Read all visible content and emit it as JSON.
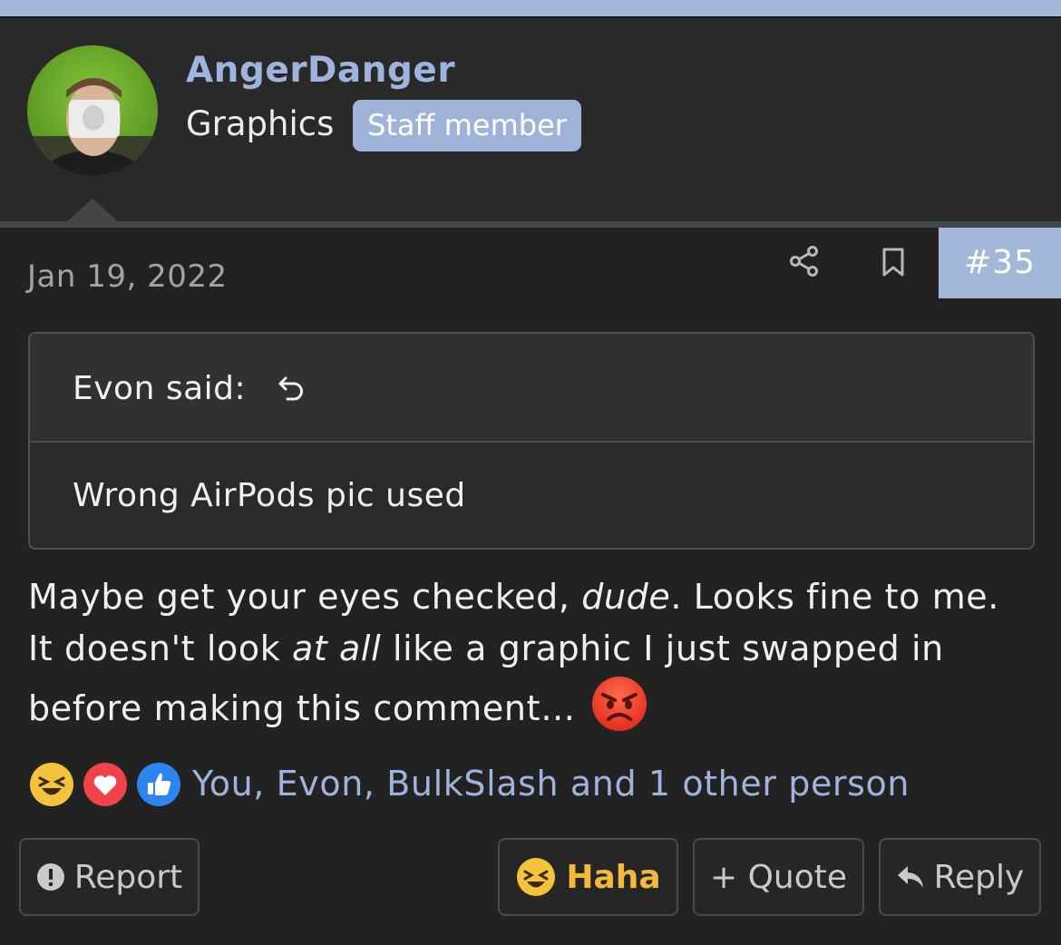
{
  "colors": {
    "accent": "#9fb4dc",
    "badge": "#9fb3d8",
    "post_number_bg": "#a3b7d9",
    "background": "#222223",
    "haha_text": "#f2b93c"
  },
  "header": {
    "username": "AngerDanger",
    "user_title": "Graphics",
    "badge": "Staff member",
    "avatar_icon": "user-avatar-photo"
  },
  "post": {
    "date": "Jan 19, 2022",
    "number": "#35",
    "share_icon": "share-icon",
    "bookmark_icon": "bookmark-icon"
  },
  "quote": {
    "author": "Evon said:",
    "jump_icon": "undo-arrow-icon",
    "text": "Wrong AirPods pic used"
  },
  "body": {
    "part1": "Maybe get your eyes checked, ",
    "italic1": "dude",
    "part2": ". Looks fine to me. It doesn't look ",
    "italic2": "at all",
    "part3": " like a graphic I just swapped in before making this comment…",
    "emoji": "angry-face"
  },
  "reactions": {
    "icons": [
      "haha-icon",
      "love-icon",
      "like-icon"
    ],
    "people": "You, Evon, BulkSlash and 1 other person"
  },
  "actions": {
    "report": "Report",
    "haha": "Haha",
    "quote": "+ Quote",
    "reply": "Reply"
  }
}
